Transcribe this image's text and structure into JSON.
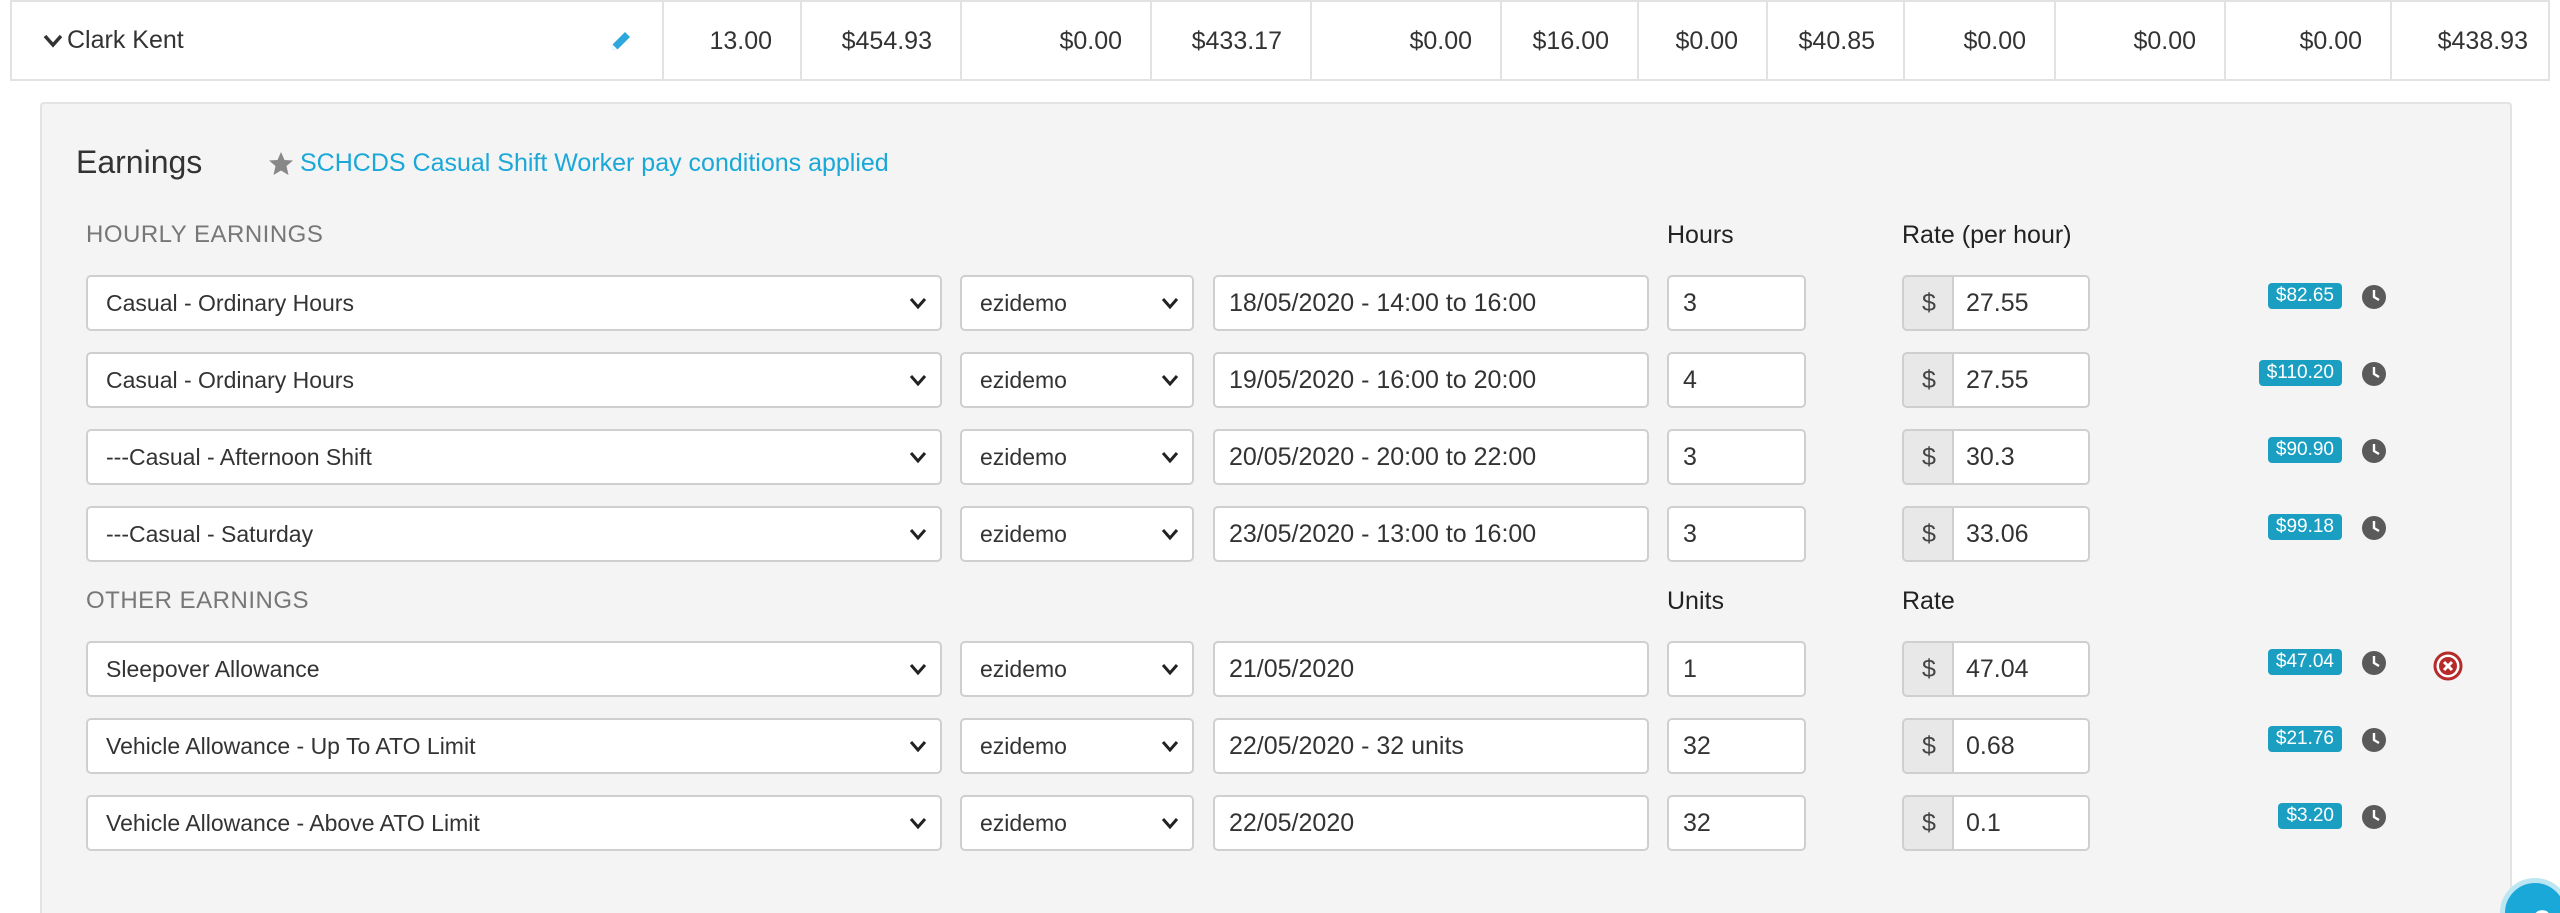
{
  "employee": {
    "name": "Clark Kent",
    "summary_values": [
      "13.00",
      "$454.93",
      "$0.00",
      "$433.17",
      "$0.00",
      "$16.00",
      "$0.00",
      "$40.85",
      "$0.00",
      "$0.00",
      "$0.00",
      "$438.93"
    ]
  },
  "earnings": {
    "title": "Earnings",
    "conditions": "SCHCDS Casual Shift Worker pay conditions applied",
    "hourly_label": "HOURLY EARNINGS",
    "hours_header": "Hours",
    "rate_hour_header": "Rate (per hour)",
    "other_label": "OTHER EARNINGS",
    "units_header": "Units",
    "rate_header": "Rate",
    "currency_symbol": "$",
    "hourly_rows": [
      {
        "type": "Casual - Ordinary Hours",
        "user": "ezidemo",
        "period": "18/05/2020 - 14:00 to 16:00",
        "qty": "3",
        "rate": "27.55",
        "total": "$82.65"
      },
      {
        "type": "Casual - Ordinary Hours",
        "user": "ezidemo",
        "period": "19/05/2020 - 16:00 to 20:00",
        "qty": "4",
        "rate": "27.55",
        "total": "$110.20"
      },
      {
        "type": "---Casual - Afternoon Shift",
        "user": "ezidemo",
        "period": "20/05/2020 - 20:00 to 22:00",
        "qty": "3",
        "rate": "30.3",
        "total": "$90.90"
      },
      {
        "type": "---Casual - Saturday",
        "user": "ezidemo",
        "period": "23/05/2020 - 13:00 to 16:00",
        "qty": "3",
        "rate": "33.06",
        "total": "$99.18"
      }
    ],
    "other_rows": [
      {
        "type": "Sleepover Allowance",
        "user": "ezidemo",
        "period": "21/05/2020",
        "qty": "1",
        "rate": "47.04",
        "total": "$47.04"
      },
      {
        "type": "Vehicle Allowance - Up To ATO Limit",
        "user": "ezidemo",
        "period": "22/05/2020 - 32 units",
        "qty": "32",
        "rate": "0.68",
        "total": "$21.76"
      },
      {
        "type": "Vehicle Allowance - Above ATO Limit",
        "user": "ezidemo",
        "period": "22/05/2020",
        "qty": "32",
        "rate": "0.1",
        "total": "$3.20"
      }
    ]
  },
  "help": {
    "label": "?"
  },
  "colors": {
    "accent": "#1aa8d8",
    "badge": "#1a9fc2",
    "remove": "#c0392b"
  }
}
